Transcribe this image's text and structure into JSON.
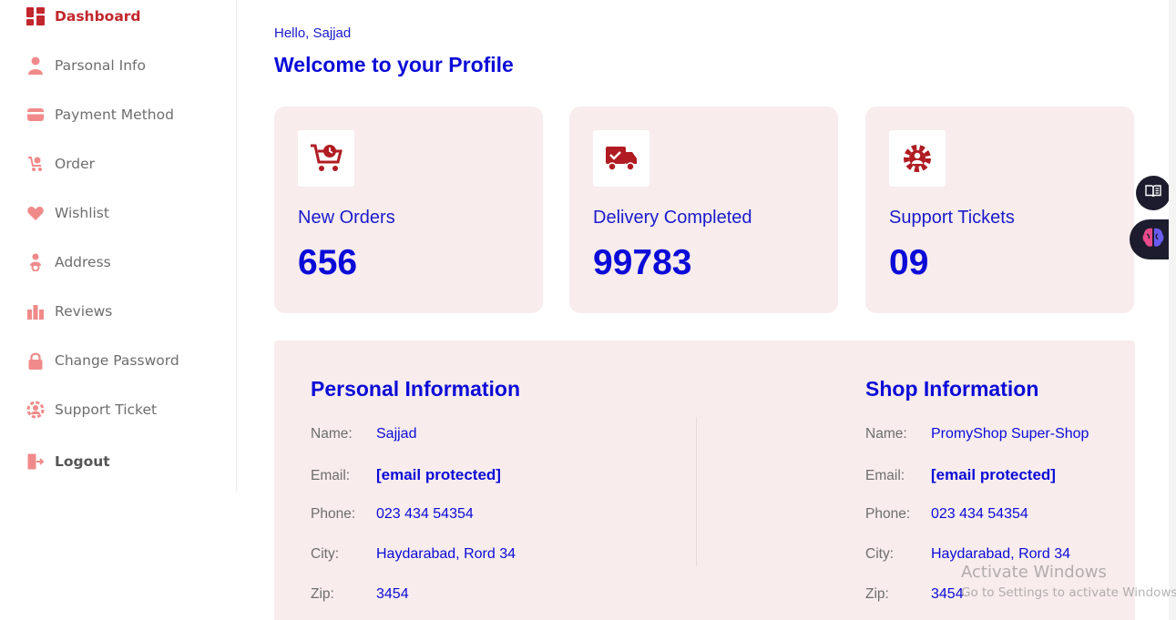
{
  "sidebar": {
    "items": [
      {
        "label": "Dashboard",
        "icon": "dashboard-icon"
      },
      {
        "label": "Parsonal Info",
        "icon": "user-icon"
      },
      {
        "label": "Payment Method",
        "icon": "card-icon"
      },
      {
        "label": "Order",
        "icon": "order-cart-icon"
      },
      {
        "label": "Wishlist",
        "icon": "heart-icon"
      },
      {
        "label": "Address",
        "icon": "location-person-icon"
      },
      {
        "label": "Reviews",
        "icon": "review-icon"
      },
      {
        "label": "Change Password",
        "icon": "lock-icon"
      },
      {
        "label": "Support Ticket",
        "icon": "support-icon"
      },
      {
        "label": "Logout",
        "icon": "logout-icon"
      }
    ],
    "active": "Dashboard"
  },
  "header": {
    "hello": "Hello, Sajjad",
    "welcome": "Welcome to your Profile"
  },
  "stats": [
    {
      "title": "New Orders",
      "value": "656",
      "icon": "cart-clock-icon"
    },
    {
      "title": "Delivery Completed",
      "value": "99783",
      "icon": "delivery-truck-icon"
    },
    {
      "title": "Support Tickets",
      "value": "09",
      "icon": "support-gear-icon"
    }
  ],
  "personal": {
    "title": "Personal Information",
    "rows": [
      {
        "key": "Name:",
        "value": "Sajjad"
      },
      {
        "key": "Email:",
        "value": "[email protected]"
      },
      {
        "key": "Phone:",
        "value": "023 434 54354"
      },
      {
        "key": "City:",
        "value": "Haydarabad, Rord 34"
      },
      {
        "key": "Zip:",
        "value": "3454"
      }
    ]
  },
  "shop": {
    "title": "Shop Information",
    "rows": [
      {
        "key": "Name:",
        "value": "PromyShop Super-Shop"
      },
      {
        "key": "Email:",
        "value": "[email protected]"
      },
      {
        "key": "Phone:",
        "value": "023 434 54354"
      },
      {
        "key": "City:",
        "value": "Haydarabad, Rord 34"
      },
      {
        "key": "Zip:",
        "value": "3454"
      }
    ]
  },
  "watermark": {
    "line1": "Activate Windows",
    "line2": "Go to Settings to activate Windows."
  },
  "floating": {
    "book_icon": "book-icon",
    "brain_icon": "brain-icon"
  },
  "colors": {
    "accent_red": "#c1272d",
    "icon_pink": "#f08a8a",
    "blue_text": "#0b0bd8",
    "card_bg": "#f8ecec"
  }
}
